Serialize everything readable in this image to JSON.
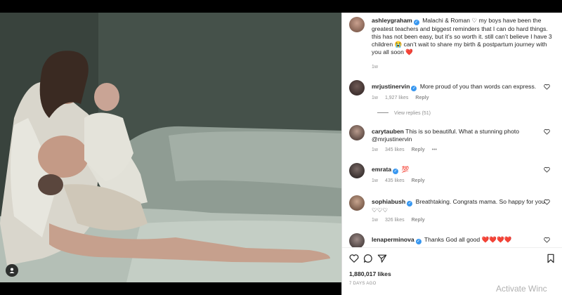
{
  "post": {
    "author": "ashleygraham",
    "caption": "Malachi & Roman ♡ my boys have been the greatest teachers and biggest reminders that I can do hard things. this has not been easy, but it’s so worth it. still can’t believe I have 3 children 😭 can’t wait to share my birth & postpartum journey with you all soon ❤️",
    "time": "1w",
    "likes": "1,880,017 likes",
    "posted_ago": "7 DAYS AGO"
  },
  "comments": [
    {
      "user": "mrjustinervin",
      "verified": true,
      "text": "More proud of you than words can express.",
      "time": "1w",
      "likes": "1,927 likes",
      "reply": "Reply",
      "view_replies": "View replies (51)"
    },
    {
      "user": "carytauben",
      "verified": false,
      "text": "This is so beautiful. What a stunning photo @mrjustinervin",
      "time": "1w",
      "likes": "345 likes",
      "reply": "Reply",
      "more": "•••"
    },
    {
      "user": "emrata",
      "verified": true,
      "text": "💯",
      "time": "1w",
      "likes": "435 likes",
      "reply": "Reply"
    },
    {
      "user": "sophiabush",
      "verified": true,
      "text": "Breathtaking. Congrats mama. So happy for you ♡♡♡",
      "time": "1w",
      "likes": "326 likes",
      "reply": "Reply"
    },
    {
      "user": "lenaperminova",
      "verified": true,
      "text": "Thanks God all good ❤️❤️❤️❤️",
      "time": "",
      "likes": "",
      "reply": ""
    }
  ],
  "watermark": "Activate Winc",
  "icons": [
    "heart-icon",
    "comment-icon",
    "share-icon",
    "bookmark-icon",
    "user-tag-icon"
  ]
}
